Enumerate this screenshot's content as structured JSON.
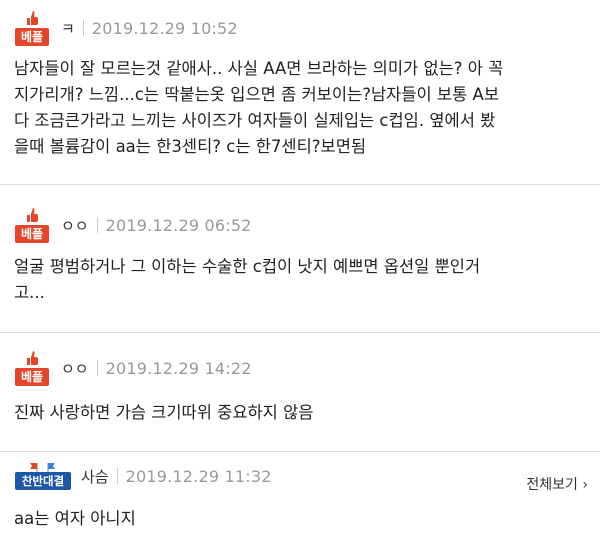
{
  "comments": [
    {
      "badge": "베플",
      "nick": "ㅋ",
      "date": "2019.12.29 10:52",
      "lines": [
        "남자들이 잘 모르는것 같애사.. 사실 AA면 브라하는 의미가 없는? 아 꼭",
        "지가리개? 느낌...c는 딱붙는옷 입으면 좀 커보이는?남자들이 보통 A보",
        "다 조금큰가라고 느끼는 사이즈가 여자들이 실제입는 c컵임. 옆에서 봤",
        "을때 볼륨감이 aa는 한3센티? c는 한7센티?보면됨"
      ]
    },
    {
      "badge": "베플",
      "nick": "ㅇㅇ",
      "date": "2019.12.29 06:52",
      "lines": [
        "얼굴 평범하거나 그 이하는 수술한 c컵이 낫지 예쁘면 옵션일 뿐인거",
        "고..."
      ]
    },
    {
      "badge": "베플",
      "nick": "ㅇㅇ",
      "date": "2019.12.29 14:22",
      "lines": [
        "진짜 사랑하면 가슴 크기따위 중요하지 않음"
      ]
    },
    {
      "badge": "찬반대결",
      "nick": "사슴",
      "date": "2019.12.29 11:32",
      "view_all": "전체보기 ›",
      "lines": [
        "aa는 여자 아니지"
      ]
    }
  ],
  "colors": {
    "best_badge": "#e5462a",
    "debate_badge": "#1d58a8",
    "date_text": "#999999"
  }
}
